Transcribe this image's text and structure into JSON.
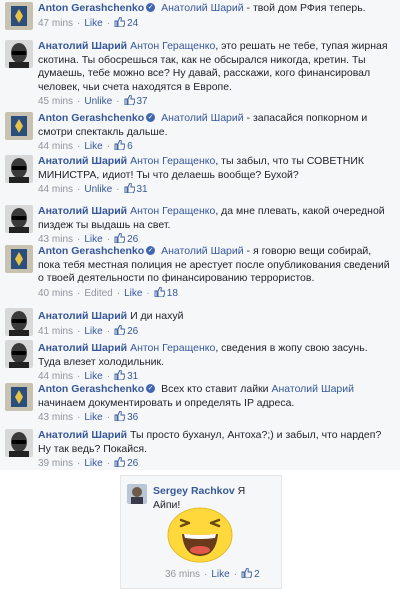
{
  "comments": [
    {
      "author": "Anton Gerashchenko",
      "verified": true,
      "mention": "Анатолий Шарий",
      "text": " - твой дом РФия теперь.",
      "time": "47 mins",
      "action": "Like",
      "likes": "24"
    },
    {
      "author": "Анатолий Шарий",
      "verified": false,
      "mention": "Антон Геращенко",
      "text": ", это решать не тебе, тупая жирная скотина. Ты обосрешься так, как не обсырался никогда, кретин. Ты думаешь, тебе можно все? Ну давай, расскажи, кого финансировал человек, чьи счета находятся в Европе.",
      "time": "45 mins",
      "action": "Unlike",
      "likes": "37"
    },
    {
      "author": "Anton Gerashchenko",
      "verified": true,
      "mention": "Анатолий Шарий",
      "text": " - запасайся попкорном и смотри спектакль дальше.",
      "time": "44 mins",
      "action": "Like",
      "likes": "6"
    },
    {
      "author": "Анатолий Шарий",
      "verified": false,
      "mention": "Антон Геращенко",
      "text": ", ты забыл, что ты СОВЕТНИК МИНИСТРА, идиот! Ты что делаешь вообще? Бухой?",
      "time": "44 mins",
      "action": "Unlike",
      "likes": "31"
    },
    {
      "author": "Анатолий Шарий",
      "verified": false,
      "mention": "Антон Геращенко",
      "text": ", да мне плевать, какой очередной пиздеж ты выдашь на свет.",
      "time": "43 mins",
      "action": "Like",
      "likes": "26"
    },
    {
      "author": "Anton Gerashchenko",
      "verified": true,
      "mention": "Анатолий Шарий",
      "text": " - я говорю вещи собирай, пока тебя местная полиция не арестует после опубликования сведений о твоей деятельности по финансированию террористов.",
      "time": "40 mins",
      "edited": "Edited",
      "action": "Like",
      "likes": "18"
    },
    {
      "author": "Анатолий Шарий",
      "verified": false,
      "mention": "",
      "text": "И ди нахуй",
      "time": "41 mins",
      "action": "Like",
      "likes": "26"
    },
    {
      "author": "Анатолий Шарий",
      "verified": false,
      "mention": "Антон Геращенко",
      "text": ", сведения в жопу свою засунь. Туда влезет холодильник.",
      "time": "44 mins",
      "action": "Like",
      "likes": "31"
    },
    {
      "author": "Anton Gerashchenko",
      "verified": true,
      "mention": "",
      "text": "Всех кто ставит лайки ",
      "mention2": "Анатолий Шарий",
      "text2": " начинаем документировать и определять IP адреса.",
      "time": "43 mins",
      "action": "Like",
      "likes": "36"
    },
    {
      "author": "Анатолий Шарий",
      "verified": false,
      "mention": "",
      "text": "Ты просто буханул, Антоха?;) и забыл, что нардеп? Ну так ведь? Покайся.",
      "time": "39 mins",
      "action": "Like",
      "likes": "26"
    }
  ],
  "card": {
    "author": "Sergey Rachkov",
    "text": "Я Айпи!",
    "time": "36 mins",
    "action": "Like",
    "likes": "2",
    "sticker": "laughing-smiley-sticker"
  },
  "colors": {
    "link": "#365899",
    "meta": "#90949c",
    "feed_bg": "#f6f7f9",
    "sticker": "#ffd93b"
  }
}
